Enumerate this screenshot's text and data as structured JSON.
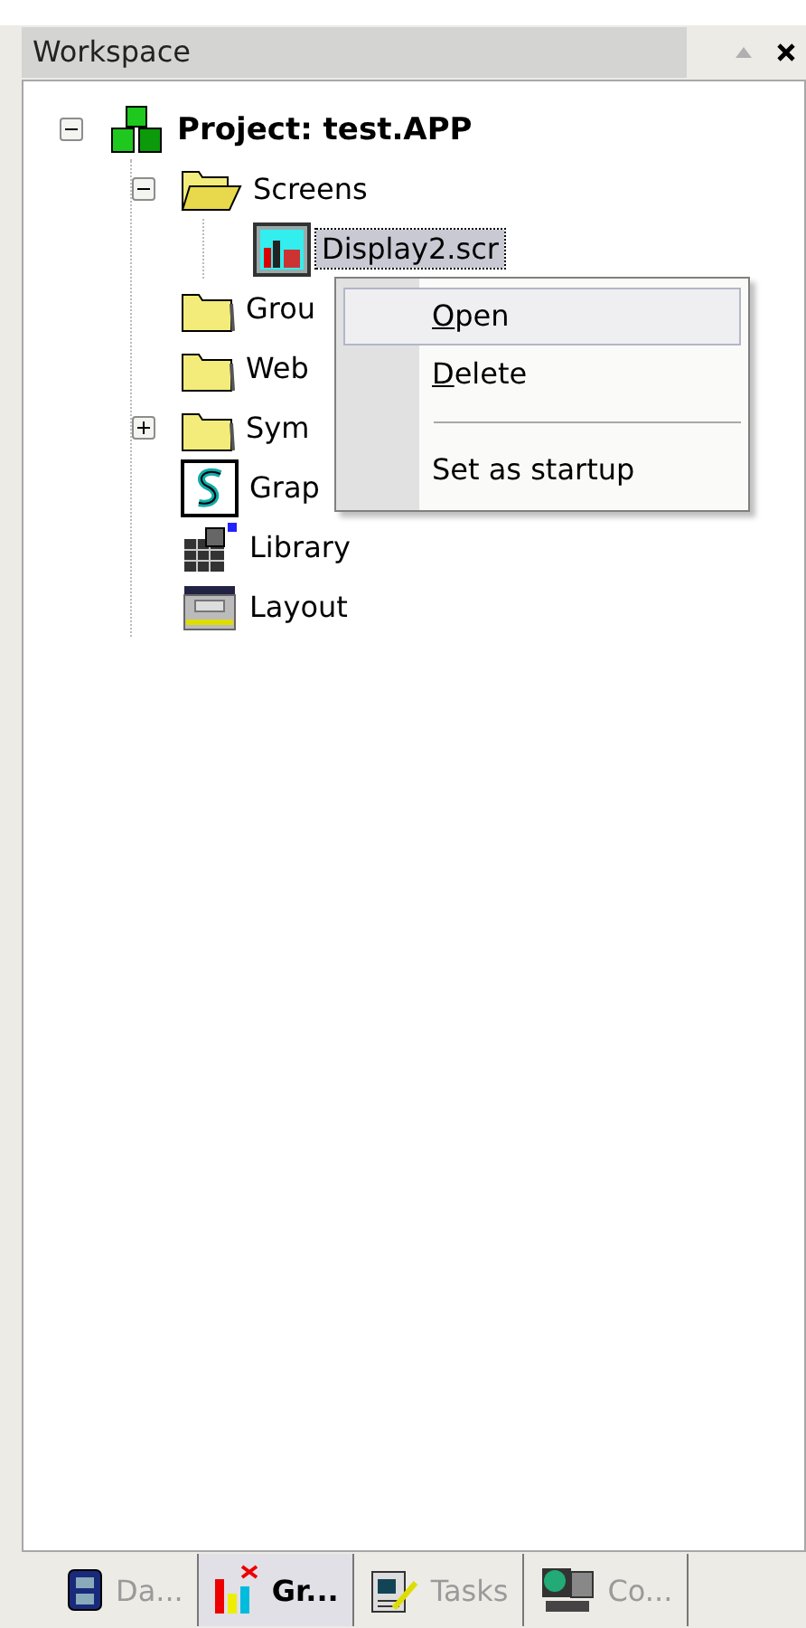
{
  "panel": {
    "title": "Workspace"
  },
  "tree": [
    {
      "label": "Project: test.APP",
      "kind": "project",
      "bold": true,
      "expanded": true,
      "children": [
        {
          "label": "Screens",
          "kind": "folder-open",
          "expanded": true,
          "children": [
            {
              "label": "Display2.scr",
              "kind": "screen",
              "selected": true
            }
          ]
        },
        {
          "label": "Grou",
          "kind": "folder"
        },
        {
          "label": "Web",
          "kind": "folder"
        },
        {
          "label": "Sym",
          "kind": "folder",
          "expanded": false
        },
        {
          "label": "Grap",
          "kind": "graphics"
        },
        {
          "label": "Library",
          "kind": "library"
        },
        {
          "label": "Layout",
          "kind": "layout"
        }
      ]
    }
  ],
  "context_menu": [
    {
      "kind": "item",
      "label": "Open",
      "mnemonic": true,
      "selected": true
    },
    {
      "kind": "item",
      "label": "Delete",
      "mnemonic": true,
      "selected": false
    },
    {
      "kind": "separator"
    },
    {
      "kind": "item",
      "label": "Set as startup",
      "mnemonic": false,
      "selected": false
    }
  ],
  "tabs": [
    {
      "label": "Da...",
      "kind": "cabinet",
      "selected": false
    },
    {
      "label": "Gr...",
      "kind": "chart",
      "selected": true
    },
    {
      "label": "Tasks",
      "kind": "tasks",
      "selected": false
    },
    {
      "label": "Co...",
      "kind": "computer",
      "selected": false
    }
  ]
}
